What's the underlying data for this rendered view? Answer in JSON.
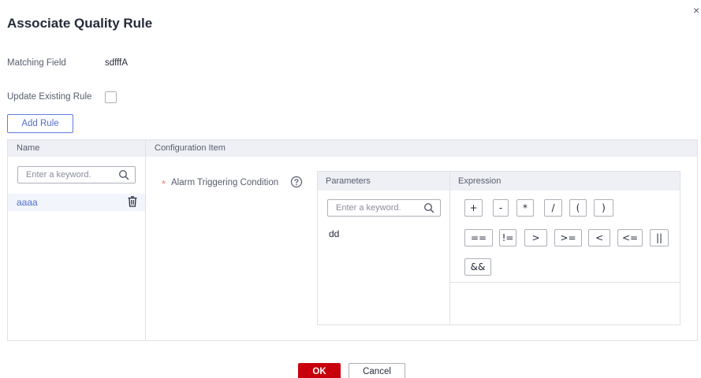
{
  "dialog": {
    "title": "Associate Quality Rule",
    "close_glyph": "×",
    "close_icon": "close-icon"
  },
  "form": {
    "matching_field_label": "Matching Field",
    "matching_field_value": "sdfffA",
    "update_existing_label": "Update Existing Rule",
    "update_existing_checked": false,
    "add_rule_label": "Add Rule"
  },
  "table": {
    "columns": [
      "Name",
      "Configuration Item"
    ],
    "search_placeholder": "Enter a keyword.",
    "search_value": "",
    "rules": [
      {
        "name": "aaaa",
        "icon": "trash-icon"
      }
    ]
  },
  "config": {
    "required_mark": "*",
    "condition_label": "Alarm Triggering Condition",
    "help_icon": "help-icon",
    "parameters_header": "Parameters",
    "expression_header": "Expression",
    "param_search_placeholder": "Enter a keyword.",
    "param_search_value": "",
    "parameters": [
      "dd"
    ],
    "operators_row1": [
      "+",
      "-",
      "*",
      "/",
      "(",
      ")"
    ],
    "operators_row2": [
      "==",
      "!=",
      ">",
      ">=",
      "<",
      "<=",
      "||"
    ],
    "operators_row3": [
      "&&"
    ]
  },
  "footer": {
    "ok_label": "OK",
    "cancel_label": "Cancel"
  },
  "colors": {
    "primary": "#5e7ce0",
    "danger": "#c7000b",
    "header_bg": "#eef0f5",
    "required": "#f66f6a"
  }
}
